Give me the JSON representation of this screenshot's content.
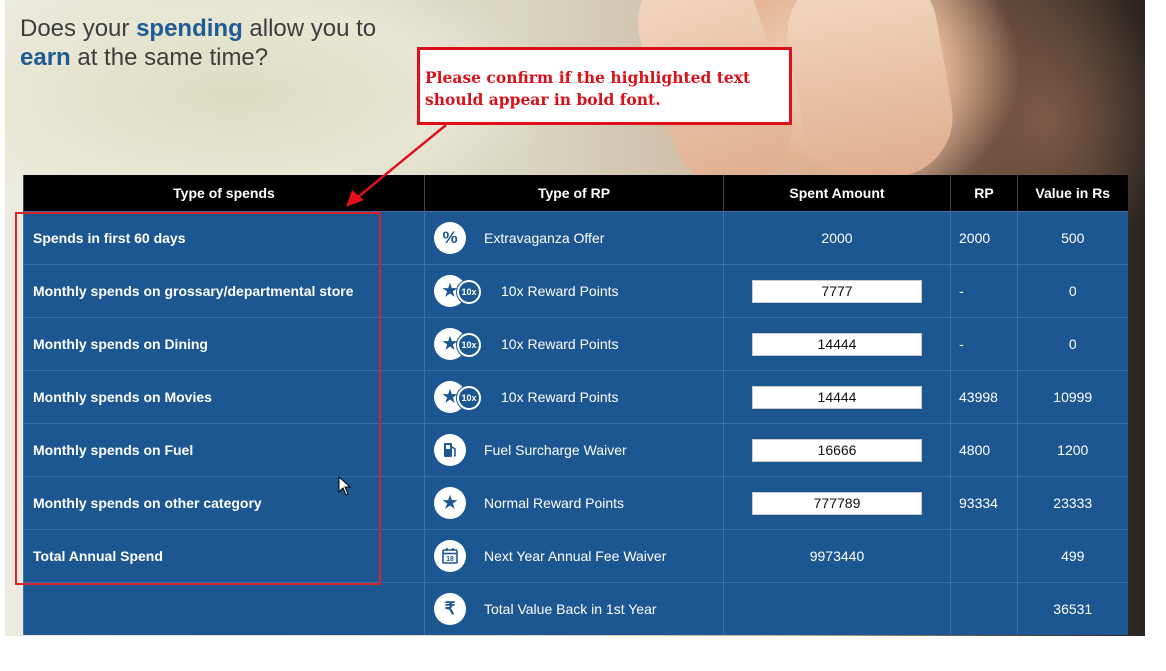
{
  "headline": {
    "part1": "Does your ",
    "highlight1": "spending",
    "part2": " allow you to ",
    "highlight2": "earn",
    "part3": " at the same time?"
  },
  "callout": {
    "line1": "Please confirm if the highlighted text",
    "line2": "should appear in bold font."
  },
  "table": {
    "headers": [
      "Type of spends",
      "Type of RP",
      "Spent Amount",
      "RP",
      "Value in Rs"
    ],
    "rows": [
      {
        "spend": "Spends in first 60 days",
        "icon": "percent-icon",
        "rp_type": "Extravaganza Offer",
        "amount": "2000",
        "rp": "2000",
        "value": "500"
      },
      {
        "spend": "Monthly spends on grossary/departmental store",
        "icon": "star-10x-icon",
        "rp_type": "10x Reward Points",
        "amount": "7777",
        "rp": "-",
        "value": "0"
      },
      {
        "spend": "Monthly spends on Dining",
        "icon": "star-10x-icon",
        "rp_type": "10x Reward Points",
        "amount": "14444",
        "rp": "-",
        "value": "0"
      },
      {
        "spend": "Monthly spends on Movies",
        "icon": "star-10x-icon",
        "rp_type": "10x Reward Points",
        "amount": "14444",
        "rp": "43998",
        "value": "10999"
      },
      {
        "spend": "Monthly spends on Fuel",
        "icon": "fuel-pump-icon",
        "rp_type": "Fuel Surcharge Waiver",
        "amount": "16666",
        "rp": "4800",
        "value": "1200"
      },
      {
        "spend": "Monthly spends on other category",
        "icon": "star-icon",
        "rp_type": "Normal Reward Points",
        "amount": "777789",
        "rp": "93334",
        "value": "23333"
      },
      {
        "spend": "Total Annual Spend",
        "icon": "calendar-icon",
        "rp_type": "Next Year Annual Fee Waiver",
        "amount": "9973440",
        "rp": "",
        "value": "499"
      },
      {
        "spend": "",
        "icon": "rupee-icon",
        "rp_type": "Total Value Back in 1st Year",
        "amount": "",
        "rp": "",
        "value": "36531"
      }
    ],
    "badge_10x": "10x",
    "calendar_day": "18"
  },
  "colors": {
    "accent": "#1f5b94",
    "table_bg": "#1d5792",
    "header_bg": "#000000",
    "annotation_red": "#e0101a"
  }
}
